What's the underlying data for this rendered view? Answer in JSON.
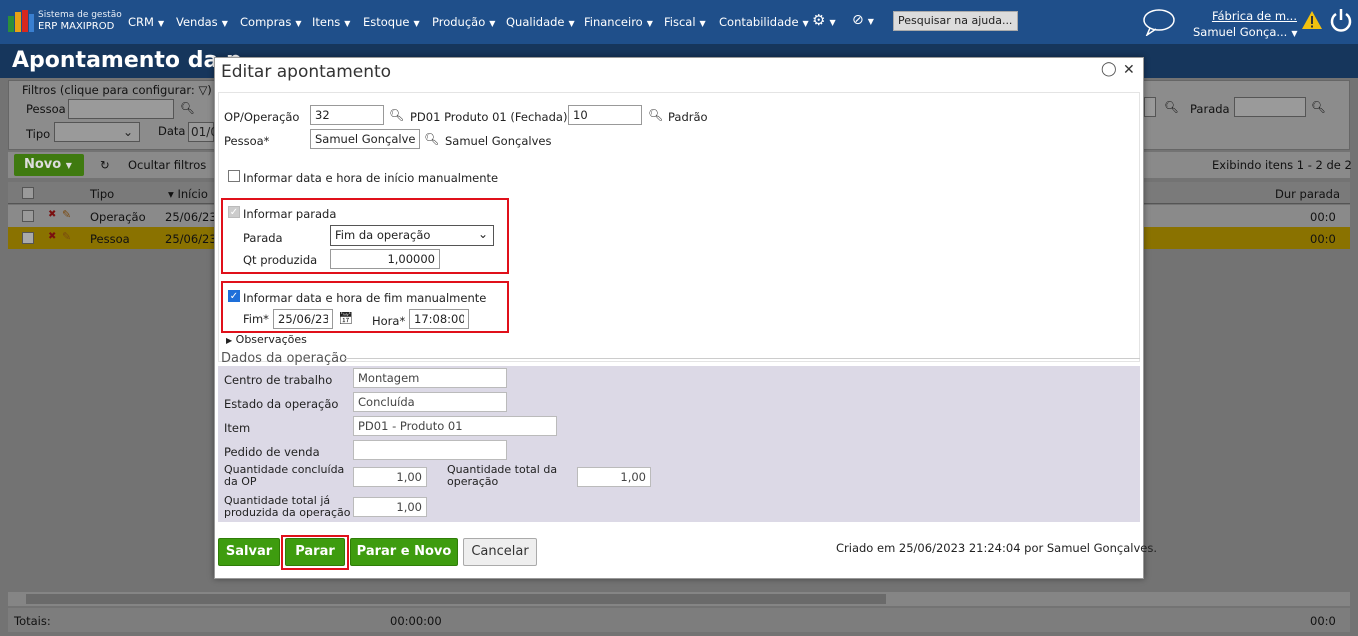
{
  "topbar": {
    "brand_line1": "Sistema de gestão",
    "brand_line2": "ERP MAXIPROD",
    "menus": [
      "CRM",
      "Vendas",
      "Compras",
      "Itens",
      "Estoque",
      "Produção",
      "Qualidade",
      "Financeiro",
      "Fiscal",
      "Contabilidade"
    ],
    "search_placeholder": "Pesquisar na ajuda...",
    "company": "Fábrica de m...",
    "user": "Samuel Gonça..."
  },
  "background": {
    "page_title": "Apontamento da p",
    "filters_label": "Filtros (clique para configurar:",
    "filter_pessoa": "Pessoa",
    "filter_tipo": "Tipo",
    "filter_data": "Data",
    "filter_data_value": "01/0",
    "filter_parada": "Parada",
    "new_button": "Novo",
    "hide_filters": "Ocultar filtros",
    "items_count": "Exibindo itens 1 - 2 de 2",
    "col_tipo": "Tipo",
    "col_inicio": "Início",
    "col_dur_parada": "Dur parada",
    "rows": [
      {
        "tipo": "Operação",
        "inicio": "25/06/23",
        "dur": "00:0"
      },
      {
        "tipo": "Pessoa",
        "inicio": "25/06/23",
        "dur": "00:0"
      }
    ],
    "totals_label": "Totais:",
    "totals_time": "00:00:00",
    "totals_right": "00:0"
  },
  "modal": {
    "title": "Editar apontamento",
    "op_label": "OP/Operação",
    "op_value": "32",
    "op_desc": "PD01 Produto 01 (Fechada)",
    "op_seq": "10",
    "op_route": "Padrão",
    "pessoa_label": "Pessoa*",
    "pessoa_value": "Samuel Gonçalves",
    "pessoa_desc": "Samuel Gonçalves",
    "start_manual_label": "Informar data e hora de início manualmente",
    "parada_check_label": "Informar parada",
    "parada_label": "Parada",
    "parada_value": "Fim da operação",
    "qt_label": "Qt produzida",
    "qt_value": "1,00000",
    "end_manual_label": "Informar data e hora de fim manualmente",
    "fim_label": "Fim*",
    "fim_value": "25/06/23",
    "hora_label": "Hora*",
    "hora_value": "17:08:00",
    "obs_label": "Observações",
    "section_title": "Dados da operação",
    "centro_label": "Centro de trabalho",
    "centro_value": "Montagem",
    "estado_label": "Estado da operação",
    "estado_value": "Concluída",
    "item_label": "Item",
    "item_value": "PD01 - Produto 01",
    "pedido_label": "Pedido de venda",
    "pedido_value": "",
    "qtd_concluida_label_1": "Quantidade concluída",
    "qtd_concluida_label_2": "da OP",
    "qtd_concluida_value": "1,00",
    "qtd_total_label_1": "Quantidade total da",
    "qtd_total_label_2": "operação",
    "qtd_total_value": "1,00",
    "qtd_produzida_label_1": "Quantidade total já",
    "qtd_produzida_label_2": "produzida da operação",
    "qtd_produzida_value": "1,00",
    "btn_salvar": "Salvar",
    "btn_parar": "Parar",
    "btn_parar_novo": "Parar e Novo",
    "btn_cancelar": "Cancelar",
    "created_text": "Criado em 25/06/2023 21:24:04 por Samuel Gonçalves."
  },
  "colors": {
    "topbar": "#1f4f8a",
    "green": "#3e9c0f",
    "highlight_red": "#e0101a",
    "section_bg": "#dcd9e6"
  }
}
